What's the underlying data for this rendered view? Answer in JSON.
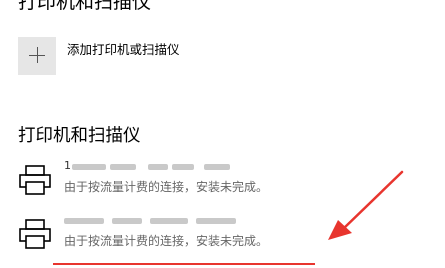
{
  "header": {
    "title": "打印机和扫描仪"
  },
  "add_device": {
    "label": "添加打印机或扫描仪",
    "icon": "plus-icon"
  },
  "section": {
    "title": "打印机和扫描仪"
  },
  "devices": [
    {
      "name_visible": "1",
      "status": "由于按流量计费的连接，安装未完成。",
      "icon": "printer-icon"
    },
    {
      "name_visible": "",
      "status": "由于按流量计费的连接，安装未完成。",
      "icon": "printer-icon"
    }
  ],
  "colors": {
    "annotation": "#e8352e",
    "tile": "#e6e6e6"
  }
}
